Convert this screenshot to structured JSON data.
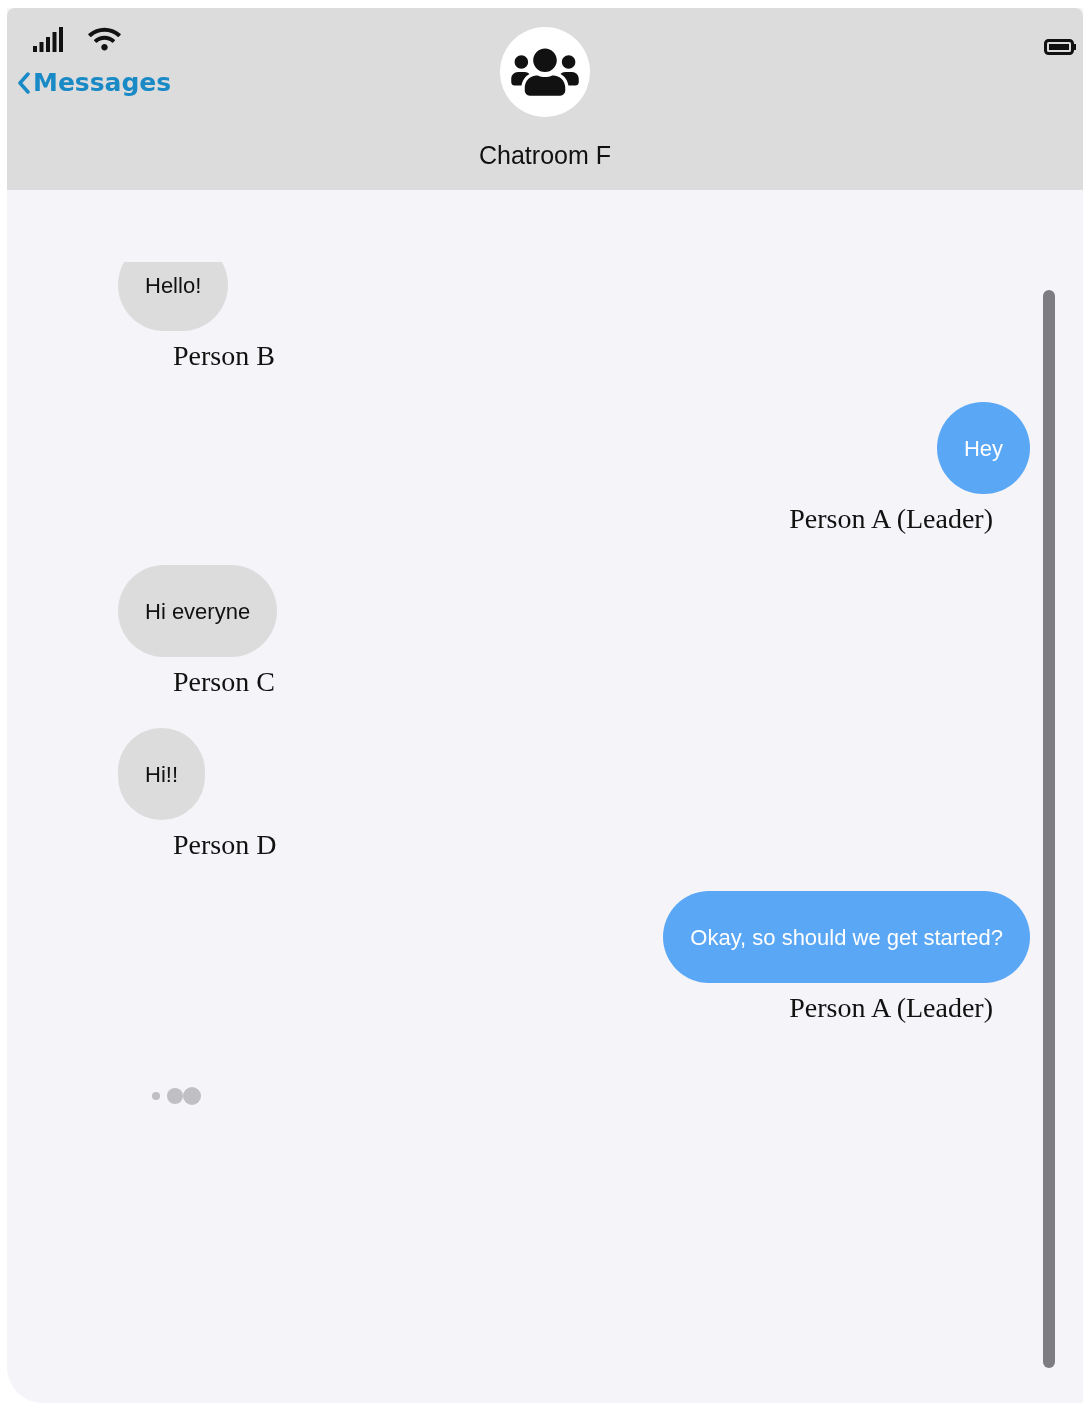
{
  "header": {
    "back_label": "Messages",
    "title": "Chatroom F"
  },
  "messages": [
    {
      "kind": "received",
      "text": "Hello!",
      "sender": "Person B"
    },
    {
      "kind": "sent",
      "text": "Hey",
      "sender": "Person A (Leader)"
    },
    {
      "kind": "received",
      "text": "Hi everyne",
      "sender": "Person C"
    },
    {
      "kind": "received",
      "text": "Hi!!",
      "sender": "Person D"
    },
    {
      "kind": "sent",
      "text": "Okay, so should we get started?",
      "sender": "Person A (Leader)"
    }
  ],
  "typing_indicator": true
}
